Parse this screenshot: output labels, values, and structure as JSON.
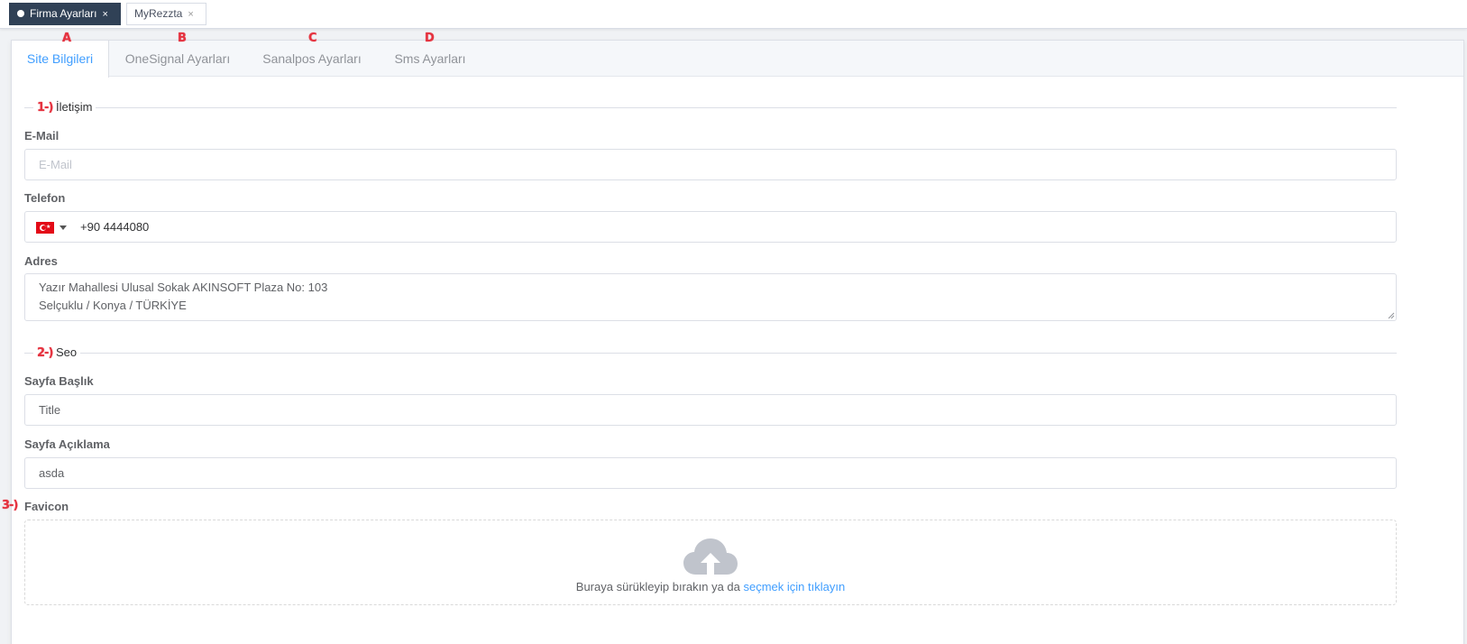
{
  "page_tabs": [
    {
      "label": "Firma Ayarları",
      "active": true
    },
    {
      "label": "MyRezzta",
      "active": false
    }
  ],
  "tab_close_glyph": "×",
  "settings_tabs": [
    {
      "label": "Site Bilgileri",
      "marker": "A",
      "active": true
    },
    {
      "label": "OneSignal Ayarları",
      "marker": "B",
      "active": false
    },
    {
      "label": "Sanalpos Ayarları",
      "marker": "C",
      "active": false
    },
    {
      "label": "Sms Ayarları",
      "marker": "D",
      "active": false
    }
  ],
  "sections": {
    "contact": {
      "marker": "1-)",
      "title": "İletişim"
    },
    "seo": {
      "marker": "2-)",
      "title": "Seo"
    },
    "favicon_marker": "3-)"
  },
  "fields": {
    "email": {
      "label": "E-Mail",
      "value": "",
      "placeholder": "E-Mail"
    },
    "phone": {
      "label": "Telefon",
      "country": "TR",
      "value": "+90 4444080"
    },
    "address": {
      "label": "Adres",
      "line1": "Yazır Mahallesi Ulusal Sokak AKINSOFT Plaza No: 103",
      "line2": "Selçuklu / Konya / TÜRKİYE"
    },
    "page_title": {
      "label": "Sayfa Başlık",
      "value": "Title"
    },
    "page_description": {
      "label": "Sayfa Açıklama",
      "value": "asda"
    },
    "favicon": {
      "label": "Favicon",
      "upload_text": "Buraya sürükleyip bırakın ya da ",
      "upload_link": "seçmek için tıklayın"
    }
  },
  "colors": {
    "accent": "#409eff",
    "active_page_tab": "#304156",
    "marker": "#e5323f"
  },
  "icons": {
    "upload": "cloud-upload-icon",
    "flag": "turkey-flag-icon",
    "dropdown": "caret-down-icon"
  }
}
